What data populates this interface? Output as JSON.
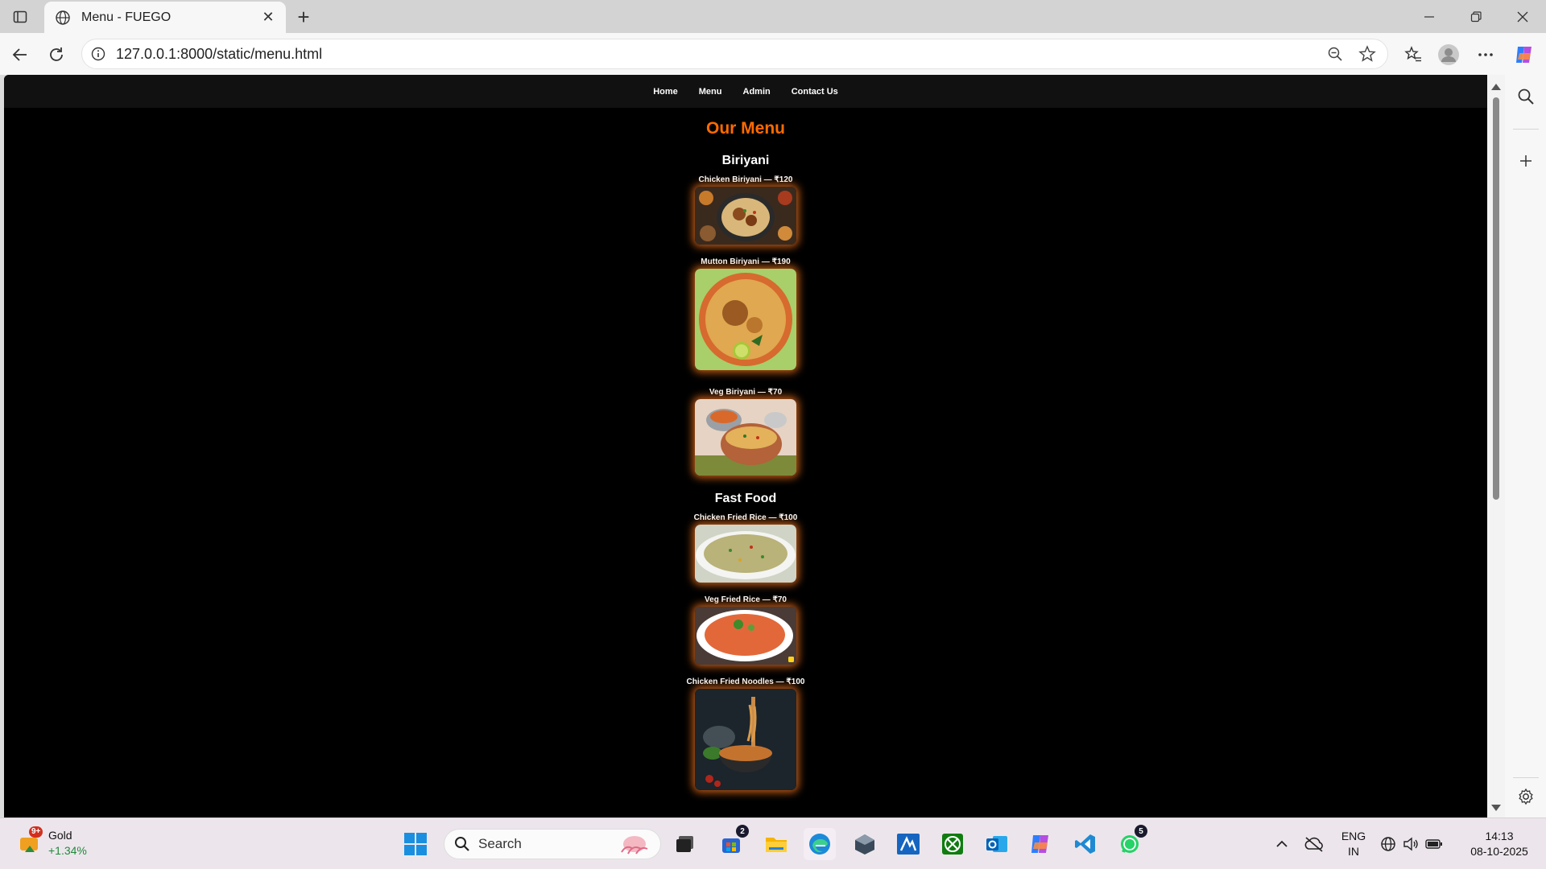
{
  "browser": {
    "tab_title": "Menu - FUEGO",
    "url": "127.0.0.1:8000/static/menu.html"
  },
  "site": {
    "nav": [
      "Home",
      "Menu",
      "Admin",
      "Contact Us"
    ],
    "title": "Our Menu",
    "categories": [
      {
        "name": "Biriyani",
        "items": [
          {
            "label": "Chicken Biriyani — ₹120",
            "photo": "chicken-biriyani-photo"
          },
          {
            "label": "Mutton Biriyani — ₹190",
            "photo": "mutton-biriyani-photo"
          },
          {
            "label": "Veg Biriyani — ₹70",
            "photo": "veg-biriyani-photo"
          }
        ]
      },
      {
        "name": "Fast Food",
        "items": [
          {
            "label": "Chicken Fried Rice — ₹100",
            "photo": "chicken-fried-rice-photo"
          },
          {
            "label": "Veg Fried Rice — ₹70",
            "photo": "veg-fried-rice-photo"
          },
          {
            "label": "Chicken Fried Noodles — ₹100",
            "photo": "chicken-fried-noodles-photo"
          }
        ]
      }
    ]
  },
  "taskbar": {
    "weather_badge": "9+",
    "weather_title": "Gold",
    "weather_change": "+1.34%",
    "search_placeholder": "Search",
    "store_badge": "2",
    "whatsapp_badge": "5",
    "lang_top": "ENG",
    "lang_bottom": "IN",
    "time": "14:13",
    "date": "08-10-2025"
  },
  "colors": {
    "accent": "#ff6a00",
    "page_bg": "#000000",
    "nav_bg": "#111111",
    "glow": "#ff7a1e"
  }
}
